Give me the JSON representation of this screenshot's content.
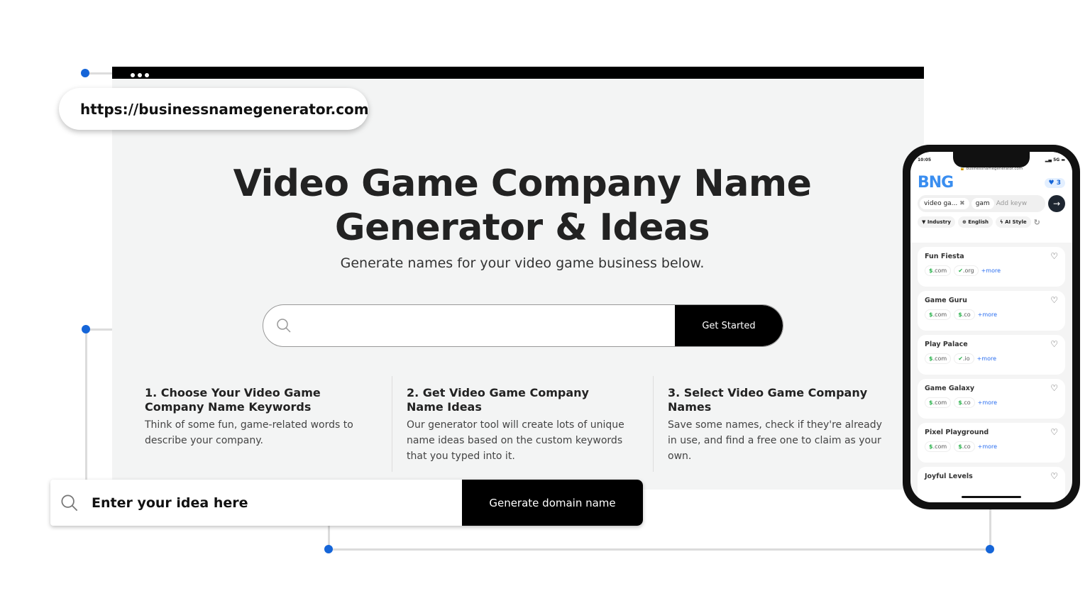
{
  "browser": {
    "url": "https://businessnamegenerator.com"
  },
  "hero": {
    "title_line1": "Video Game Company Name",
    "title_line2": "Generator & Ideas",
    "subtitle": "Generate names for your video game business below.",
    "search_button": "Get Started"
  },
  "steps": [
    {
      "title": "1. Choose Your Video Game Company Name Keywords",
      "text": "Think of some fun, game-related words to describe your company."
    },
    {
      "title": "2. Get Video Game Company Name Ideas",
      "text": "Our generator tool will create lots of unique name ideas based on the custom keywords that you typed into it."
    },
    {
      "title": "3. Select Video Game Company Names",
      "text": "Save some names, check if they're already in use, and find a free one to claim as your own."
    }
  ],
  "idea_bar": {
    "placeholder": "Enter your idea here",
    "button": "Generate domain name"
  },
  "phone": {
    "time": "10:05",
    "signal": "5G",
    "url": "businessnamegenerator.com",
    "logo": "BNG",
    "favorites_count": "3",
    "keywords": [
      "video ga...",
      "gam"
    ],
    "keyword_placeholder": "Add keyw",
    "filters": [
      "Industry",
      "English",
      "AI Style"
    ],
    "results": [
      {
        "name": "Fun Fiesta",
        "tlds": [
          {
            "icon": "dollar",
            "ext": ".com"
          },
          {
            "icon": "check",
            "ext": ".org"
          }
        ]
      },
      {
        "name": "Game Guru",
        "tlds": [
          {
            "icon": "dollar",
            "ext": ".com"
          },
          {
            "icon": "dollar",
            "ext": ".co"
          }
        ]
      },
      {
        "name": "Play Palace",
        "tlds": [
          {
            "icon": "dollar",
            "ext": ".com"
          },
          {
            "icon": "check",
            "ext": ".io"
          }
        ]
      },
      {
        "name": "Game Galaxy",
        "tlds": [
          {
            "icon": "dollar",
            "ext": ".com"
          },
          {
            "icon": "dollar",
            "ext": ".co"
          }
        ]
      },
      {
        "name": "Pixel Playground",
        "tlds": [
          {
            "icon": "dollar",
            "ext": ".com"
          },
          {
            "icon": "dollar",
            "ext": ".co"
          }
        ]
      },
      {
        "name": "Joyful Levels",
        "tlds": []
      }
    ],
    "more_label": "+more"
  },
  "colors": {
    "accent": "#1565d8",
    "available": "#2bb24c",
    "button": "#000000"
  }
}
